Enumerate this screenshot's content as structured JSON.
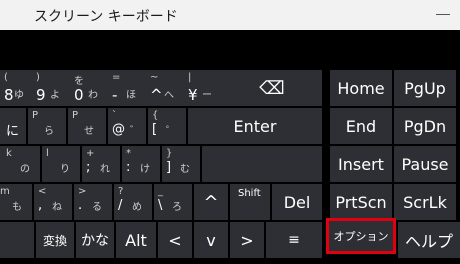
{
  "window": {
    "title": "スクリーン キーボード"
  },
  "row1": {
    "k8": {
      "top": "(",
      "bot": "8",
      "kana": "ゆ"
    },
    "k9": {
      "top": ")",
      "bot": "9",
      "kana": "よ"
    },
    "k0": {
      "top": "を",
      "bot": "0",
      "kana": "わ"
    },
    "minus": {
      "top": "=",
      "bot": "-",
      "kana": "ほ"
    },
    "caret": {
      "top": "~",
      "bot": "^",
      "kana": "へ"
    },
    "yen": {
      "top": "|",
      "bot": "¥",
      "kana": "ー"
    },
    "backspace": "⌫"
  },
  "row2": {
    "o": {
      "bot": "に"
    },
    "p": {
      "top": "P",
      "kana": "ら"
    },
    "at": {
      "top": "`",
      "bot": "@",
      "kana": "゛"
    },
    "p2": {
      "top": "P",
      "kana": "せ"
    },
    "bracket": {
      "top": "{",
      "bot": "[",
      "kana": "゜"
    },
    "enter": "Enter"
  },
  "row3": {
    "k": {
      "top": "k",
      "kana": "の"
    },
    "l": {
      "top": "l",
      "kana": "り"
    },
    "semi": {
      "top": "+",
      "bot": ";",
      "kana": "れ"
    },
    "colon": {
      "top": "*",
      "bot": ":",
      "kana": "け"
    },
    "rbracket": {
      "top": "}",
      "bot": "]",
      "kana": "む"
    }
  },
  "row4": {
    "m": {
      "top": "m",
      "kana": "も"
    },
    "comma": {
      "top": "<",
      "bot": ",",
      "kana": "ね"
    },
    "period": {
      "top": ">",
      "bot": ".",
      "kana": "る"
    },
    "slash": {
      "top": "?",
      "bot": "/",
      "kana": "め"
    },
    "backslash": {
      "top": "_",
      "bot": "\\",
      "kana": "ろ"
    },
    "up": "^",
    "shift": "Shift",
    "del": "Del"
  },
  "row5": {
    "henkan": "変換",
    "kana": "かな",
    "alt": "Alt",
    "left": "<",
    "down": "v",
    "right": ">",
    "menu": "≡"
  },
  "nav": {
    "home": "Home",
    "pgup": "PgUp",
    "end": "End",
    "pgdn": "PgDn",
    "insert": "Insert",
    "pause": "Pause",
    "prtscn": "PrtScn",
    "scrlk": "ScrLk",
    "options": "オプション",
    "help": "ヘルプ"
  }
}
